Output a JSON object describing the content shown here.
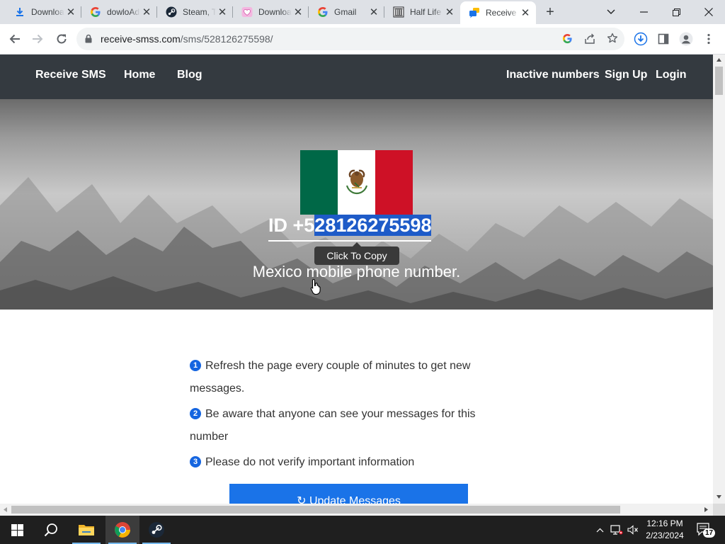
{
  "browser": {
    "tabs": [
      {
        "title": "Download",
        "favicon": "download-icon"
      },
      {
        "title": "dowloAd",
        "favicon": "google-icon"
      },
      {
        "title": "Steam, The",
        "favicon": "steam-icon"
      },
      {
        "title": "Download",
        "favicon": "heart-icon"
      },
      {
        "title": "Gmail",
        "favicon": "google-icon"
      },
      {
        "title": "Half Life",
        "favicon": "museum-icon"
      },
      {
        "title": "Receive",
        "favicon": "chat-icon",
        "active": true
      }
    ],
    "address": {
      "host": "receive-smss.com",
      "path": "/sms/528126275598/"
    }
  },
  "site": {
    "nav_left": [
      "Receive SMS",
      "Home",
      "Blog"
    ],
    "nav_right": [
      "Inactive numbers",
      "Sign Up",
      "Login"
    ],
    "hero": {
      "id_prefix": "ID +5",
      "id_selected": "28126275598",
      "tooltip": "Click To Copy",
      "subtitle": "Mexico mobile phone number."
    },
    "steps": [
      {
        "num": "1",
        "text": "Refresh the page every couple of minutes to get new messages."
      },
      {
        "num": "2",
        "text": "Be aware that anyone can see your messages for this number"
      },
      {
        "num": "3",
        "text": "Please do not verify important information"
      }
    ],
    "update_button": "↻ Update Messages",
    "flag_colors": [
      "#006847",
      "#ffffff",
      "#ce1126"
    ]
  },
  "taskbar": {
    "time": "12:16 PM",
    "date": "2/23/2024",
    "notifications": "17"
  }
}
